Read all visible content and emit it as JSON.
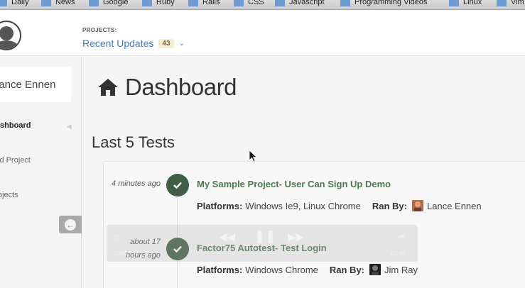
{
  "bookmarks": [
    {
      "label": "Daily"
    },
    {
      "label": "News"
    },
    {
      "label": "Google"
    },
    {
      "label": "Ruby"
    },
    {
      "label": "Rails"
    },
    {
      "label": "CSS"
    },
    {
      "label": "Javascript"
    },
    {
      "label": "Programming Videos"
    },
    {
      "label": "Linux"
    },
    {
      "label": "Vim"
    }
  ],
  "header": {
    "projects_label": "PROJECTS:",
    "selected_project": "Recent Updates",
    "count": "43"
  },
  "sidebar": {
    "user_name": "Lance Ennen",
    "items": [
      {
        "label": "Dashboard",
        "active": true
      },
      {
        "label": "Add Project",
        "active": false
      },
      {
        "label": "Projects",
        "active": false
      }
    ],
    "collapse_icon": "circle-left-arrow-icon"
  },
  "main": {
    "page_title": "Dashboard",
    "page_icon": "home-icon",
    "section_title": "Last 5 Tests",
    "tests": [
      {
        "time": "4 minutes ago",
        "name": "My Sample Project- User Can Sign Up Demo",
        "platforms_label": "Platforms:",
        "platforms": "Windows Ie9, Linux Chrome",
        "ranby_label": "Ran By:",
        "ranby": "Lance Ennen",
        "status_icon": "check-icon"
      },
      {
        "time": "about 17 hours ago",
        "name": "Factor75 Autotest- Test Login",
        "platforms_label": "Platforms:",
        "platforms": "Windows Chrome",
        "ranby_label": "Ran By:",
        "ranby": "Jim Ray",
        "status_icon": "check-icon"
      }
    ]
  },
  "video_overlay": {
    "time_left": "00:00",
    "time_right": "-03:45"
  },
  "colors": {
    "accent_blue": "#3c7fc1",
    "success_green": "#3f5e45",
    "test_link_green": "#4c7a4e",
    "badge_bg": "#f6ecd2"
  }
}
